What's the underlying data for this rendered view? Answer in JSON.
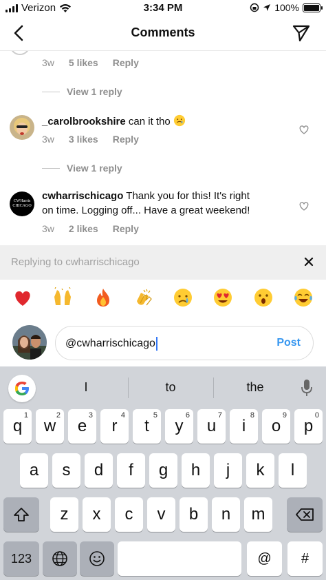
{
  "status": {
    "carrier": "Verizon",
    "time": "3:34 PM",
    "battery": "100%"
  },
  "header": {
    "title": "Comments"
  },
  "comments": [
    {
      "likes": "5 likes",
      "age": "3w",
      "reply": "Reply",
      "view_replies": "View 1 reply"
    },
    {
      "user": "_carolbrookshire",
      "text": "can it tho",
      "age": "3w",
      "likes": "3 likes",
      "reply": "Reply",
      "view_replies": "View 1 reply"
    },
    {
      "user": "cwharrischicago",
      "text_line1": "Thank you for this! It's right",
      "text_line2": "on time. Logging off... Have a great weekend!",
      "age": "3w",
      "likes": "2 likes",
      "reply": "Reply",
      "avatar_text": "CWHarris CHICAGO"
    }
  ],
  "replying": {
    "text": "Replying to cwharrischicago"
  },
  "emojis": [
    "red-heart",
    "raising-hands",
    "fire",
    "clapping-hands",
    "crying-face",
    "heart-eyes",
    "astonished-face",
    "tears-of-joy"
  ],
  "input": {
    "value": "@cwharrischicago",
    "post_label": "Post"
  },
  "keyboard": {
    "suggestions": [
      "I",
      "to",
      "the"
    ],
    "row1": [
      [
        "q",
        "1"
      ],
      [
        "w",
        "2"
      ],
      [
        "e",
        "3"
      ],
      [
        "r",
        "4"
      ],
      [
        "t",
        "5"
      ],
      [
        "y",
        "6"
      ],
      [
        "u",
        "7"
      ],
      [
        "i",
        "8"
      ],
      [
        "o",
        "9"
      ],
      [
        "p",
        "0"
      ]
    ],
    "row2": [
      "a",
      "s",
      "d",
      "f",
      "g",
      "h",
      "j",
      "k",
      "l"
    ],
    "row3": [
      "z",
      "x",
      "c",
      "v",
      "b",
      "n",
      "m"
    ],
    "bottom": {
      "numbers": "123",
      "at": "@",
      "hash": "#"
    }
  },
  "colors": {
    "accent": "#3797f0",
    "caret": "#3478f6",
    "keyboard_bg": "#d1d4d9"
  }
}
